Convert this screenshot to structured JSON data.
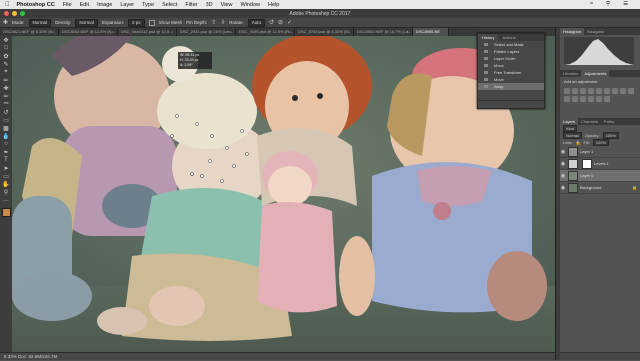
{
  "menubar": {
    "app": "Photoshop CC",
    "items": [
      "File",
      "Edit",
      "Image",
      "Layer",
      "Type",
      "Select",
      "Filter",
      "3D",
      "View",
      "Window",
      "Help"
    ]
  },
  "window": {
    "title": "Adobe Photoshop CC 2017"
  },
  "options": {
    "mode_label": "Mode:",
    "mode_value": "Normal",
    "density_label": "Density:",
    "density_value": "Normal",
    "expansion_label": "Expansion:",
    "expansion_value": "2 px",
    "show_mesh": "Show Mesh",
    "pin_depth": "Pin Depth:",
    "rotate_label": "Rotate:",
    "rotate_value": "Auto"
  },
  "tabs": [
    {
      "label": "DSC5821.NEF @ 8.33% (B..."
    },
    {
      "label": "DSC8002.NEF @ 12.5% (N..."
    },
    {
      "label": "DSC_0isn0112.psd @ 12.5..."
    },
    {
      "label": "DSC_2931.psd @ 25% (Lev..."
    },
    {
      "label": "DSC_4446.psd @ 12.5% (R..."
    },
    {
      "label": "DSC_5784.psd @ 8.33% (B..."
    },
    {
      "label": "DSC8951.NEF @ 16.7% (La..."
    },
    {
      "label": "DSC8955.NE"
    }
  ],
  "toolbox": {
    "foreground_color": "#c98b4a",
    "background_color": "#4a5a32"
  },
  "transform_readout": [
    "W: 55.31 px",
    "H: 33.33 px",
    "A: 2.59°"
  ],
  "history": {
    "tabs": [
      "History",
      "Actions"
    ],
    "items": [
      "Select and Mask",
      "Flatten Layers",
      "Layer Order",
      "Move",
      "Free Transform",
      "Move",
      "Warp"
    ],
    "selected_index": 6
  },
  "histogram": {
    "tabs": [
      "Histogram",
      "Navigator"
    ]
  },
  "adjustments": {
    "tabs": [
      "Libraries",
      "Adjustments"
    ],
    "add_label": "Add an adjustment"
  },
  "layers": {
    "tabs": [
      "Layers",
      "Channels",
      "Paths"
    ],
    "kind_label": "Kind",
    "blend_mode": "Normal",
    "opacity_label": "Opacity:",
    "opacity_value": "100%",
    "lock_label": "Lock:",
    "fill_label": "Fill:",
    "fill_value": "100%",
    "rows": [
      {
        "name": "Layer 1"
      },
      {
        "name": "Levels 1"
      },
      {
        "name": "Layer 0"
      },
      {
        "name": "Background"
      }
    ],
    "selected_index": 2
  },
  "status": {
    "text": "8.33%   Doc: 62.8M/226.7M"
  }
}
